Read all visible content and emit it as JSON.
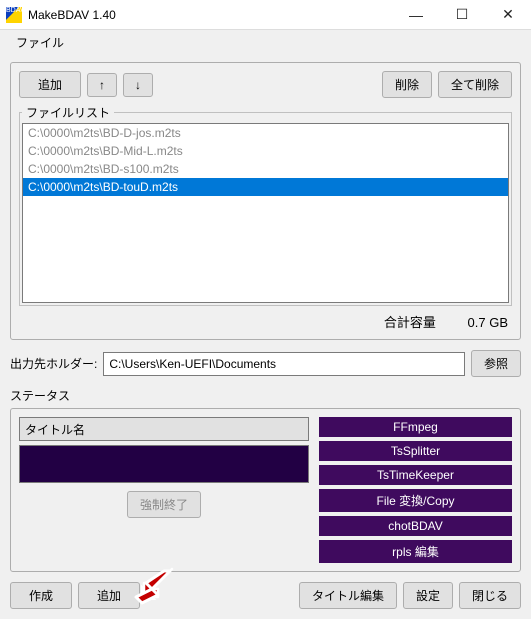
{
  "window": {
    "title": "MakeBDAV 1.40",
    "minimize": "—",
    "maximize": "☐",
    "close": "✕"
  },
  "menu": {
    "file": "ファイル"
  },
  "toolbar": {
    "add": "追加",
    "up": "↑",
    "down": "↓",
    "delete": "削除",
    "delete_all": "全て削除"
  },
  "filelist": {
    "legend": "ファイルリスト",
    "items": [
      "C:\\0000\\m2ts\\BD-D-jos.m2ts",
      "C:\\0000\\m2ts\\BD-Mid-L.m2ts",
      "C:\\0000\\m2ts\\BD-s100.m2ts",
      "C:\\0000\\m2ts\\BD-touD.m2ts"
    ],
    "selected_index": 3,
    "total_label": "合計容量",
    "total_value": "0.7 GB"
  },
  "output": {
    "label": "出力先ホルダー:",
    "path": "C:\\Users\\Ken-UEFI\\Documents",
    "browse": "参照"
  },
  "status": {
    "label": "ステータス",
    "title_label": "タイトル名",
    "abort": "強制終了",
    "stages": [
      "FFmpeg",
      "TsSplitter",
      "TsTimeKeeper",
      "File 変換/Copy",
      "chotBDAV",
      "rpls 編集"
    ]
  },
  "bottom": {
    "create": "作成",
    "add": "追加",
    "title_edit": "タイトル編集",
    "settings": "設定",
    "close": "閉じる"
  }
}
